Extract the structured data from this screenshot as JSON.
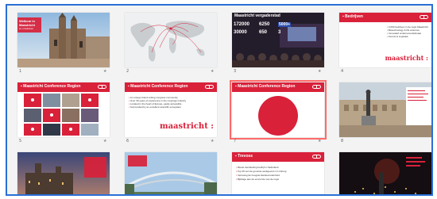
{
  "slides": [
    {
      "num": "1",
      "title": "Welkom in Maastricht",
      "subtitle": "en omstreken"
    },
    {
      "num": "2"
    },
    {
      "num": "3",
      "title": "Maastricht vergaderstad",
      "stats": [
        "172000",
        "6250",
        "5000+",
        "30000",
        "650",
        "3"
      ]
    },
    {
      "num": "4",
      "title": "Bedrijven",
      "bullets": [
        "3.000 bedrijven in de regio Maastricht",
        "Biotechnology & life sciences",
        "Innovatief ondernemersklimaat",
        "Kennis & Logistiek"
      ],
      "wordmark": "maastricht :"
    },
    {
      "num": "5",
      "title": "Maastricht Conference Region"
    },
    {
      "num": "6",
      "title": "Maastricht Conference Region",
      "bullets": [
        "An unique brand uniting congress community",
        "Over 30 years of experience in the meetings industry",
        "Located in the heart of Europe, easily accessible",
        "Surrounded by an excellent scientific ecosystem"
      ],
      "wordmark": "maastricht :"
    },
    {
      "num": "7",
      "title": "Maastricht Conference Region"
    },
    {
      "num": "8"
    },
    {
      "num": "9"
    },
    {
      "num": "10"
    },
    {
      "num": "11",
      "title": "Trevoss",
      "bullets": [
        "Meest trendsetting bedrijf in Nederland",
        "Top 25 van de grootste werkgevers in Limburg",
        "Verreweg de hoogste klanttevredenheid",
        "Bijdrage aan de economie van de regio"
      ]
    },
    {
      "num": "12"
    }
  ]
}
